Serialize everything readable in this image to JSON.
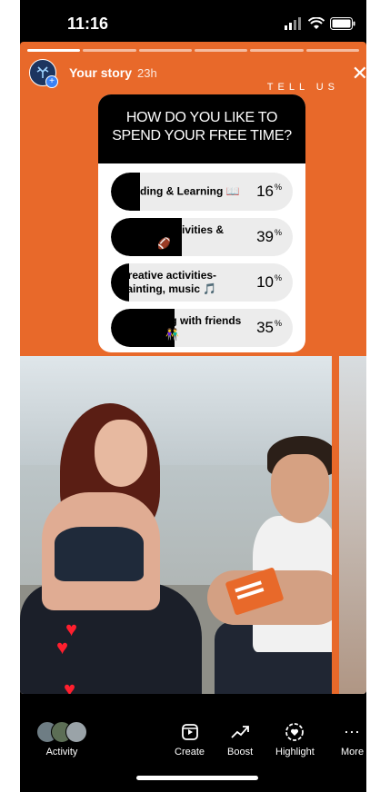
{
  "status_bar": {
    "time": "11:16"
  },
  "story": {
    "username": "Your story",
    "time_ago": "23h",
    "tell_us": "TELL US",
    "progress_segments": 6,
    "progress_done": 1
  },
  "poll": {
    "question": "HOW DO YOU LIKE TO SPEND YOUR FREE TIME?",
    "options": [
      {
        "label": "Reading & Learning 📖",
        "percent": "16",
        "value": 16
      },
      {
        "label": "Outdoor activities & Sports 🏈",
        "percent": "39",
        "value": 39
      },
      {
        "label": "Creative activities- painting, music 🎵",
        "percent": "10",
        "value": 10
      },
      {
        "label": "Socializing with friends & family 👫",
        "percent": "35",
        "value": 35
      }
    ],
    "percent_sign": "%"
  },
  "bottom_bar": {
    "items": [
      {
        "label": "Activity",
        "icon": "activity-avatars-icon"
      },
      {
        "label": "Create",
        "icon": "create-icon"
      },
      {
        "label": "Boost",
        "icon": "boost-icon"
      },
      {
        "label": "Highlight",
        "icon": "highlight-icon"
      },
      {
        "label": "More",
        "icon": "more-icon"
      }
    ]
  },
  "colors": {
    "story_bg": "#e8692a",
    "poll_fill": "#000000",
    "heart": "#ff1f2e"
  }
}
